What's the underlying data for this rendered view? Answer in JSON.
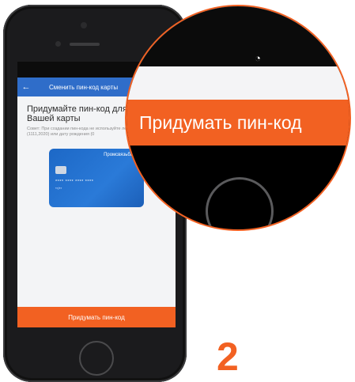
{
  "app": {
    "title": "Сменить пин-код карты",
    "back_icon": "arrow-left-icon"
  },
  "status_bar": {
    "icons": "◔◢"
  },
  "content": {
    "headline_line1": "Придумайте пин-код для",
    "headline_line2": "Вашей карты",
    "hint": "Совет: При создании пин-кода не используйте легкие комбинации (1111,2020) или дату рождения (0"
  },
  "card": {
    "bank_name": "Промсвязьбанк",
    "number_mask": "**** **** **** ****",
    "expiry_mask": "**/**"
  },
  "cta": {
    "label": "Придумать пин-код"
  },
  "magnifier": {
    "label": "Придумать пин-код",
    "status_icon": "◔"
  },
  "step": {
    "number": "2"
  },
  "colors": {
    "accent": "#f26122",
    "appbar": "#2f6dc9",
    "card": "#1d68c6"
  }
}
